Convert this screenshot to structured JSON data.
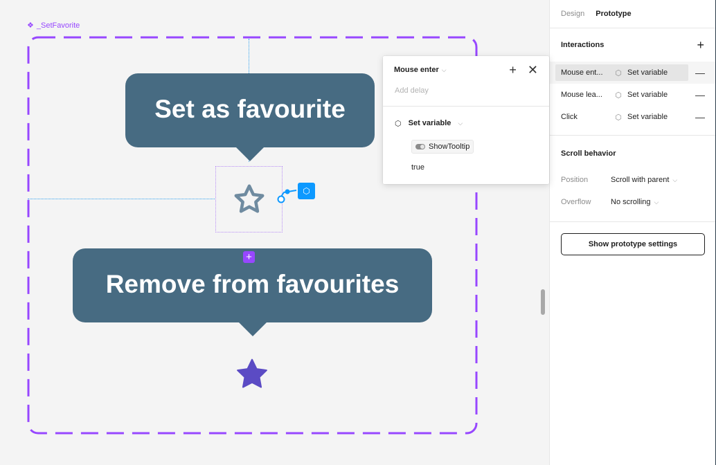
{
  "canvas": {
    "frame_label": "_SetFavorite",
    "frame_label_icon": "component-icon",
    "tooltip_set": "Set as favourite",
    "tooltip_remove": "Remove from favourites",
    "star_outline_icon": "star-outline-icon",
    "star_filled_icon": "star-filled-icon",
    "colors": {
      "frame_border": "#9747ff",
      "tooltip_bg": "#476b82",
      "star_outline": "#6f8ba0",
      "star_filled": "#5b4bc4",
      "connector": "#0d99ff"
    }
  },
  "popover": {
    "trigger": "Mouse enter",
    "add_delay_placeholder": "Add delay",
    "action": "Set variable",
    "variable": "ShowTooltip",
    "value": "true"
  },
  "panel": {
    "tabs": [
      {
        "label": "Design",
        "active": false
      },
      {
        "label": "Prototype",
        "active": true
      }
    ],
    "interactions_title": "Interactions",
    "interactions": [
      {
        "trigger": "Mouse ent...",
        "action": "Set variable",
        "selected": true
      },
      {
        "trigger": "Mouse lea...",
        "action": "Set variable",
        "selected": false
      },
      {
        "trigger": "Click",
        "action": "Set variable",
        "selected": false
      }
    ],
    "scroll_title": "Scroll behavior",
    "position_label": "Position",
    "position_value": "Scroll with parent",
    "overflow_label": "Overflow",
    "overflow_value": "No scrolling",
    "prototype_settings_button": "Show prototype settings"
  }
}
